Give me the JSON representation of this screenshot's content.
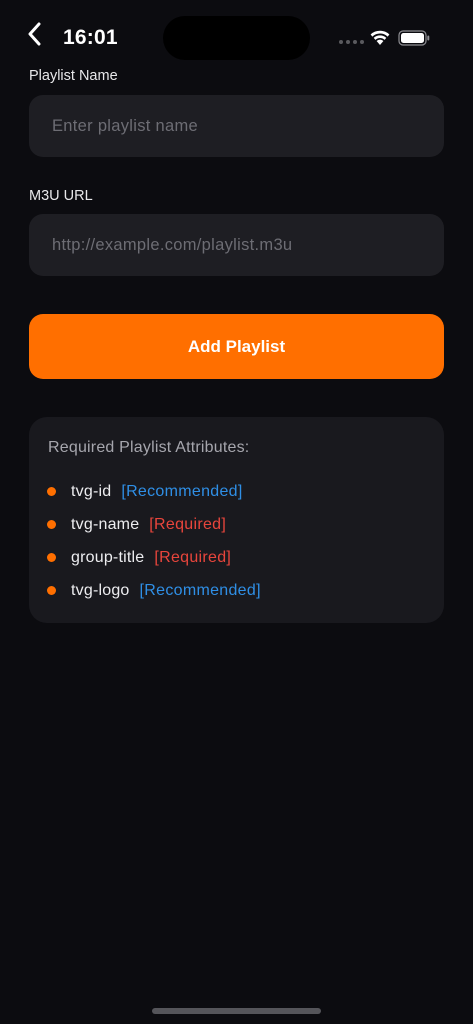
{
  "status_bar": {
    "time": "16:01"
  },
  "form": {
    "playlist_name": {
      "label": "Playlist Name",
      "value": "",
      "placeholder": "Enter playlist name"
    },
    "m3u_url": {
      "label": "M3U URL",
      "value": "",
      "placeholder": "http://example.com/playlist.m3u"
    },
    "submit_label": "Add Playlist"
  },
  "info_card": {
    "title": "Required Playlist Attributes:",
    "attributes": [
      {
        "name": "tvg-id",
        "tag": "[Recommended]"
      },
      {
        "name": "tvg-name",
        "tag": "[Required]"
      },
      {
        "name": "group-title",
        "tag": "[Required]"
      },
      {
        "name": "tvg-logo",
        "tag": "[Recommended]"
      }
    ]
  },
  "colors": {
    "accent": "#ff6f00",
    "recommended": "#2f8fe6",
    "required": "#e8453c",
    "background": "#0c0c10",
    "input_background": "#1e1e23",
    "card_background": "#19191e"
  },
  "icons": {
    "back": "chevron-left-icon",
    "wifi": "wifi-icon",
    "battery": "battery-icon"
  }
}
